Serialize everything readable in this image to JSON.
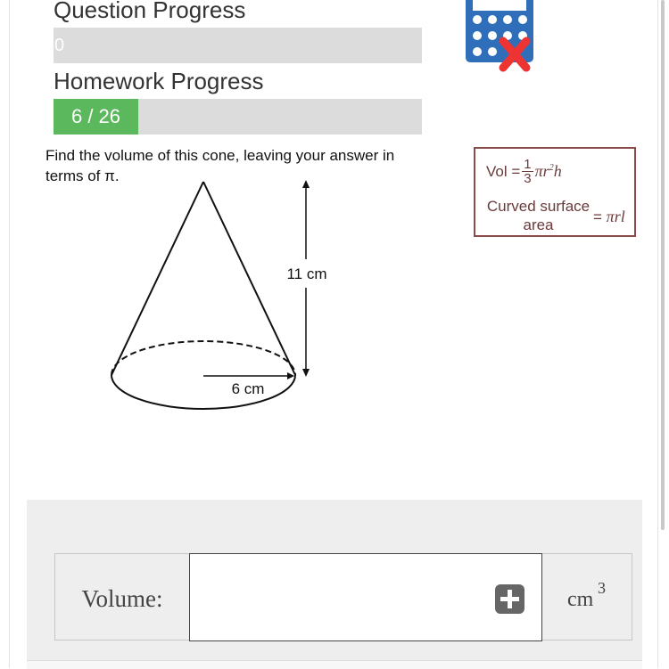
{
  "question_progress": {
    "label": "Question Progress",
    "value": "0"
  },
  "homework_progress": {
    "label": "Homework Progress",
    "value_text": "6 / 26",
    "completed": 6,
    "total": 26,
    "fill_fraction": 0.23
  },
  "calculator": {
    "icon": "calculator-not-allowed-icon",
    "status_color": "#ee3333",
    "body_color": "#2f6fba"
  },
  "question": {
    "text": "Find the volume of this cone, leaving your answer in terms of π."
  },
  "formula_box": {
    "vol_prefix": "Vol =",
    "frac_numerator": "1",
    "frac_denominator": "3",
    "vol_pi": "π",
    "vol_r": "r",
    "vol_exp": "2",
    "vol_h": "h",
    "curved_label": "Curved surface area",
    "curved_equals": "=",
    "curved_value": "πrl"
  },
  "diagram": {
    "height_label": "11 cm",
    "radius_label": "6 cm"
  },
  "answer": {
    "label": "Volume:",
    "input_value": "",
    "unit": "cm",
    "unit_exponent": "3"
  }
}
